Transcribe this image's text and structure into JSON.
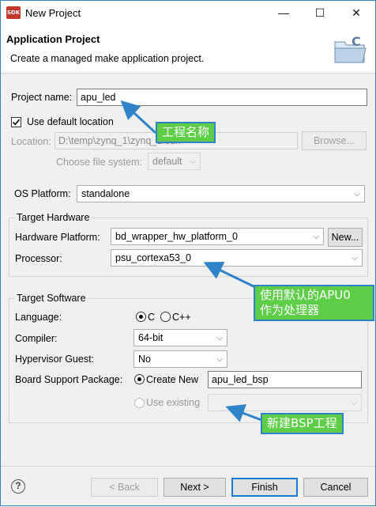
{
  "window": {
    "app_badge": "SDK",
    "title": "New Project",
    "controls": {
      "minimize": "—",
      "maximize": "☐",
      "close": "✕"
    }
  },
  "banner": {
    "title": "Application Project",
    "description": "Create a managed make application project."
  },
  "project": {
    "name_label": "Project name:",
    "name_value": "apu_led",
    "use_default_location_label": "Use default location",
    "use_default_location_checked": true,
    "location_label": "Location:",
    "location_value": "D:\\temp\\zynq_1\\zynq_1.sdk",
    "browse_label": "Browse...",
    "filesystem_label": "Choose file system:",
    "filesystem_value": "default"
  },
  "os": {
    "label": "OS Platform:",
    "value": "standalone"
  },
  "hardware": {
    "group_title": "Target Hardware",
    "platform_label": "Hardware Platform:",
    "platform_value": "bd_wrapper_hw_platform_0",
    "new_label": "New...",
    "processor_label": "Processor:",
    "processor_value": "psu_cortexa53_0"
  },
  "software": {
    "group_title": "Target Software",
    "language_label": "Language:",
    "language_c": "C",
    "language_cpp": "C++",
    "language_selected": "C",
    "compiler_label": "Compiler:",
    "compiler_value": "64-bit",
    "hypervisor_label": "Hypervisor Guest:",
    "hypervisor_value": "No",
    "bsp_label": "Board Support Package:",
    "bsp_create_new": "Create New",
    "bsp_name_value": "apu_led_bsp",
    "bsp_use_existing": "Use existing"
  },
  "annotations": {
    "project_name_note": "工程名称",
    "processor_note_line1": "使用默认的APU0",
    "processor_note_line2": "作为处理器",
    "bsp_note": "新建BSP工程",
    "accent_color": "#5ecd47",
    "arrow_color": "#2f84c9"
  },
  "footer": {
    "help_symbol": "?",
    "back_label": "< Back",
    "next_label": "Next >",
    "finish_label": "Finish",
    "cancel_label": "Cancel"
  }
}
